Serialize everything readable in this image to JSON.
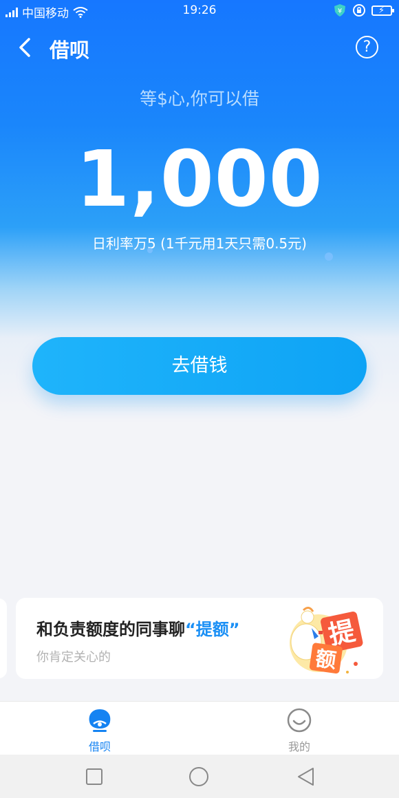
{
  "status_bar": {
    "carrier": "中国移动",
    "time": "19:26"
  },
  "nav": {
    "title": "借呗"
  },
  "hero": {
    "subtitle": "等$心,你可以借",
    "amount": "1,000",
    "rate_text": "日利率万5 (1千元用1天只需0.5元)"
  },
  "borrow_button": {
    "label": "去借钱"
  },
  "promo": {
    "title_prefix": "和负责额度的同事聊",
    "title_highlight": "“提额”",
    "subtitle": "你肯定关心的",
    "art_text_1": "提",
    "art_text_2": "额"
  },
  "tabs": [
    {
      "label": "借呗",
      "icon": "jiebei-tab-icon",
      "active": true
    },
    {
      "label": "我的",
      "icon": "smiley-icon",
      "active": false
    }
  ],
  "colors": {
    "brand_blue": "#1677ff",
    "button_blue": "#1fb4fb",
    "active_tab": "#1583f2",
    "highlight": "#1a8ff5"
  }
}
